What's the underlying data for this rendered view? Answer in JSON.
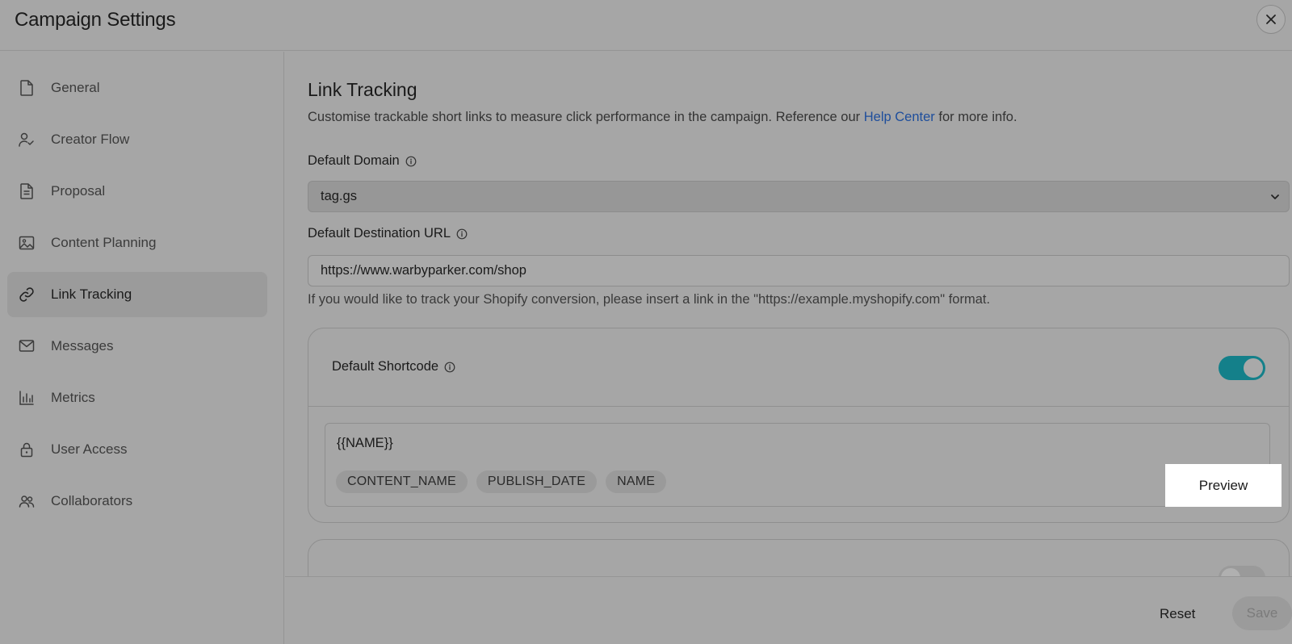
{
  "header": {
    "title": "Campaign Settings",
    "close_icon": "close-icon"
  },
  "sidebar": {
    "items": [
      {
        "label": "General",
        "icon": "document-icon"
      },
      {
        "label": "Creator Flow",
        "icon": "user-check-icon"
      },
      {
        "label": "Proposal",
        "icon": "file-text-icon"
      },
      {
        "label": "Content Planning",
        "icon": "image-icon"
      },
      {
        "label": "Link Tracking",
        "icon": "link-icon",
        "active": true
      },
      {
        "label": "Messages",
        "icon": "mail-icon"
      },
      {
        "label": "Metrics",
        "icon": "bar-chart-icon"
      },
      {
        "label": "User Access",
        "icon": "lock-icon"
      },
      {
        "label": "Collaborators",
        "icon": "users-icon"
      }
    ]
  },
  "main": {
    "title": "Link Tracking",
    "desc_before": "Customise trackable short links to measure click performance in the campaign. Reference our ",
    "desc_link": "Help Center",
    "desc_after": " for more info.",
    "domain": {
      "label": "Default Domain",
      "value": "tag.gs"
    },
    "destination": {
      "label": "Default Destination URL",
      "value": "https://www.warbyparker.com/shop",
      "helper": "If you would like to track your Shopify conversion, please insert a link in the \"https://example.myshopify.com\" format."
    },
    "shortcode": {
      "label": "Default Shortcode",
      "enabled": true,
      "value": "{{NAME}}",
      "chips": [
        "CONTENT_NAME",
        "PUBLISH_DATE",
        "NAME"
      ],
      "preview_label": "Preview"
    },
    "utm": {
      "enabled": false
    }
  },
  "footer": {
    "reset_label": "Reset",
    "save_label": "Save"
  },
  "colors": {
    "accent": "#14808a",
    "link": "#1e4e9c",
    "overlay_bg": "#a6a6a6"
  }
}
